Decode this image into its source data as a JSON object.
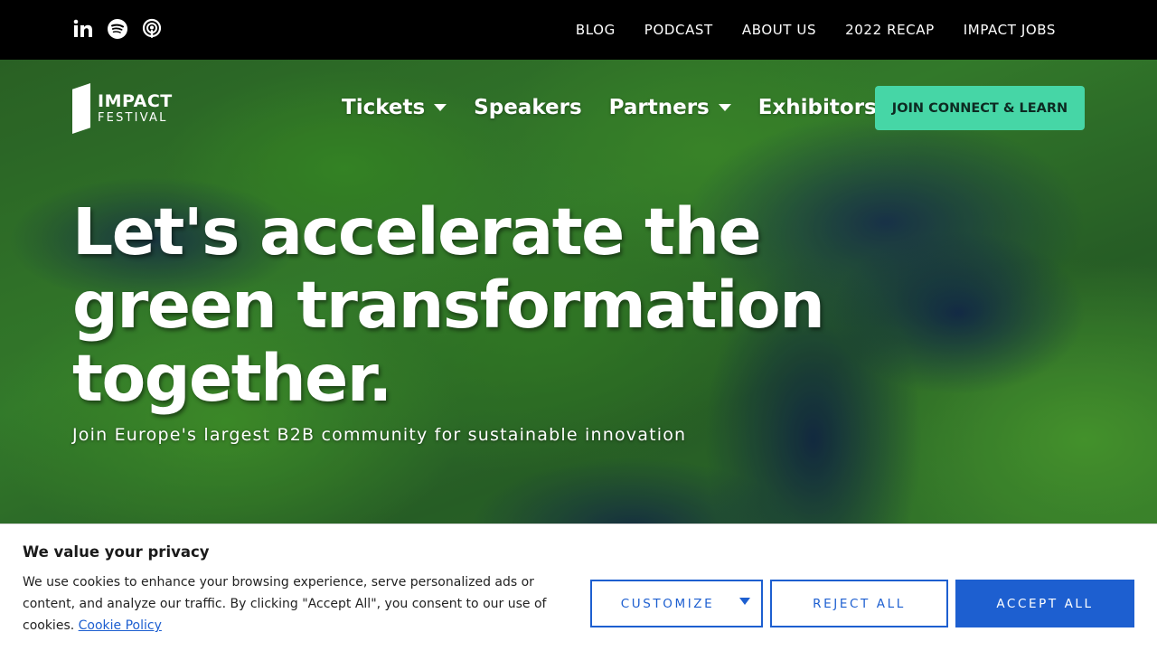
{
  "topbar": {
    "social": [
      {
        "icon": "linkedin-icon"
      },
      {
        "icon": "spotify-icon"
      },
      {
        "icon": "podcast-icon"
      }
    ],
    "links": [
      "BLOG",
      "PODCAST",
      "ABOUT US",
      "2022 RECAP",
      "IMPACT JOBS"
    ]
  },
  "header": {
    "logo_line1": "IMPACT",
    "logo_line2": "FESTIVAL",
    "nav": [
      {
        "label": "Tickets",
        "has_dropdown": true
      },
      {
        "label": "Speakers",
        "has_dropdown": false
      },
      {
        "label": "Partners",
        "has_dropdown": true
      },
      {
        "label": "Exhibitors",
        "has_dropdown": true
      }
    ],
    "cta_label": "JOIN CONNECT & LEARN",
    "cta_color": "#46d6a6"
  },
  "hero": {
    "headline_lines": [
      "Let's accelerate the",
      "green transformation",
      "together."
    ],
    "subline": "Join Europe's largest B2B community for sustainable innovation"
  },
  "cookie": {
    "title": "We value your privacy",
    "text": "We use cookies to enhance your browsing experience, serve personalized ads or content, and analyze our traffic. By clicking \"Accept All\", you consent to our use of cookies.",
    "link": "Cookie Policy",
    "customize_label": "CUSTOMIZE",
    "reject_label": "REJECT ALL",
    "accept_label": "ACCEPT ALL",
    "accent_color": "#1d5fd0"
  }
}
